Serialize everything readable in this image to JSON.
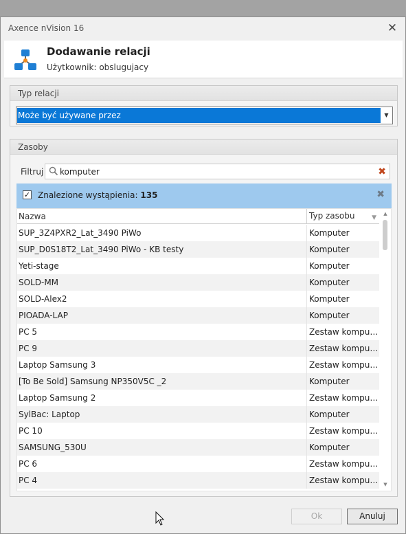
{
  "window": {
    "title": "Axence nVision 16",
    "close_label": "✕"
  },
  "header": {
    "title": "Dodawanie relacji",
    "subtitle": "Użytkownik: obslugujacy"
  },
  "relation_type": {
    "group_label": "Typ relacji",
    "selected": "Może być używane przez",
    "arrow": "▼"
  },
  "resources": {
    "group_label": "Zasoby",
    "filter_label": "Filtruj",
    "filter_value": "komputer",
    "filter_clear": "✖",
    "found_prefix": "Znalezione wystąpienia: ",
    "found_count": "135",
    "found_check": "✓",
    "found_close": "✖",
    "columns": {
      "name": "Nazwa",
      "type": "Typ zasobu"
    },
    "rows": [
      {
        "name": "SUP_3Z4PXR2_Lat_3490 PiWo",
        "type": "Komputer"
      },
      {
        "name": "SUP_D0S18T2_Lat_3490 PiWo - KB testy",
        "type": "Komputer"
      },
      {
        "name": "Yeti-stage",
        "type": "Komputer"
      },
      {
        "name": "SOLD-MM",
        "type": "Komputer"
      },
      {
        "name": "SOLD-Alex2",
        "type": "Komputer"
      },
      {
        "name": "PIOADA-LAP",
        "type": "Komputer"
      },
      {
        "name": "PC 5",
        "type": "Zestaw kompute..."
      },
      {
        "name": "PC 9",
        "type": "Zestaw kompute..."
      },
      {
        "name": "Laptop Samsung 3",
        "type": "Zestaw kompute..."
      },
      {
        "name": "[To Be Sold] Samsung NP350V5C _2",
        "type": "Komputer"
      },
      {
        "name": "Laptop Samsung 2",
        "type": "Zestaw kompute..."
      },
      {
        "name": "SylBac: Laptop",
        "type": "Komputer"
      },
      {
        "name": "PC 10",
        "type": "Zestaw kompute..."
      },
      {
        "name": "SAMSUNG_530U",
        "type": "Komputer"
      },
      {
        "name": "PC 6",
        "type": "Zestaw kompute..."
      },
      {
        "name": "PC 4",
        "type": "Zestaw kompute..."
      }
    ]
  },
  "buttons": {
    "ok": "Ok",
    "cancel": "Anuluj"
  },
  "colors": {
    "selection": "#0a78d7",
    "found_bar": "#9ec9ee",
    "clear_icon": "#c0451c"
  }
}
